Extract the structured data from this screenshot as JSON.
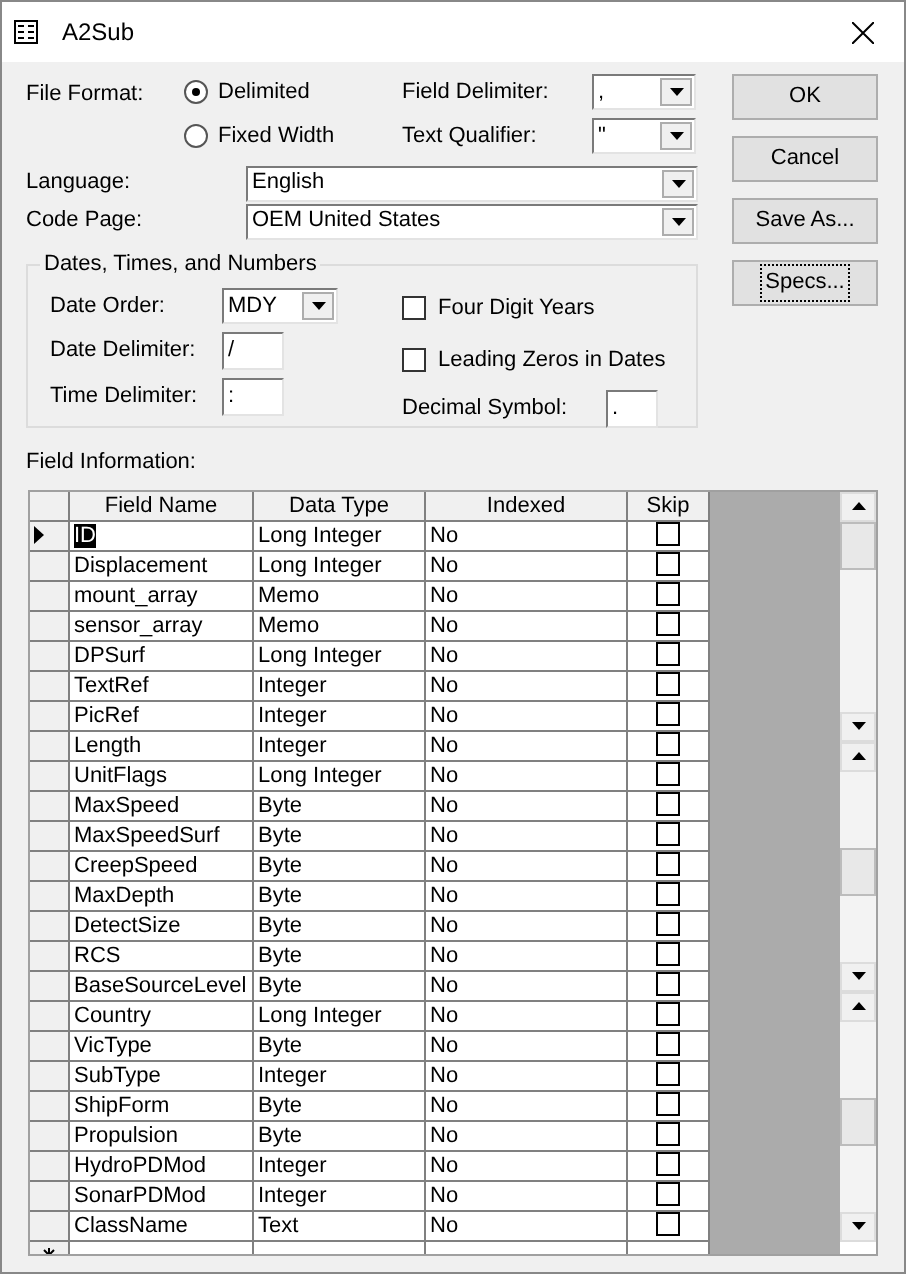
{
  "window": {
    "title": "A2Sub"
  },
  "file_format": {
    "label": "File Format:",
    "options": [
      {
        "label": "Delimited",
        "selected": true
      },
      {
        "label": "Fixed Width",
        "selected": false
      }
    ]
  },
  "field_delimiter": {
    "label": "Field Delimiter:",
    "value": ","
  },
  "text_qualifier": {
    "label": "Text Qualifier:",
    "value": "\""
  },
  "language": {
    "label": "Language:",
    "value": "English"
  },
  "code_page": {
    "label": "Code Page:",
    "value": "OEM United States"
  },
  "dates": {
    "title": "Dates, Times, and Numbers",
    "date_order": {
      "label": "Date Order:",
      "value": "MDY"
    },
    "date_delimiter": {
      "label": "Date Delimiter:",
      "value": "/"
    },
    "time_delimiter": {
      "label": "Time Delimiter:",
      "value": ":"
    },
    "four_digit_years": {
      "label": "Four Digit Years",
      "checked": false
    },
    "leading_zeros": {
      "label": "Leading Zeros in Dates",
      "checked": false
    },
    "decimal_symbol": {
      "label": "Decimal Symbol:",
      "value": "."
    }
  },
  "buttons": [
    {
      "label": "OK",
      "focused": false
    },
    {
      "label": "Cancel",
      "focused": false
    },
    {
      "label": "Save As...",
      "focused": false
    },
    {
      "label": "Specs...",
      "focused": true
    }
  ],
  "field_information": {
    "label": "Field Information:",
    "columns": [
      "Field Name",
      "Data Type",
      "Indexed",
      "Skip"
    ],
    "rows": [
      {
        "field_name": "ID",
        "data_type": "Long Integer",
        "indexed": "No",
        "skip": false,
        "selected": true
      },
      {
        "field_name": "Displacement",
        "data_type": "Long Integer",
        "indexed": "No",
        "skip": false,
        "selected": false
      },
      {
        "field_name": "mount_array",
        "data_type": "Memo",
        "indexed": "No",
        "skip": false,
        "selected": false
      },
      {
        "field_name": "sensor_array",
        "data_type": "Memo",
        "indexed": "No",
        "skip": false,
        "selected": false
      },
      {
        "field_name": "DPSurf",
        "data_type": "Long Integer",
        "indexed": "No",
        "skip": false,
        "selected": false
      },
      {
        "field_name": "TextRef",
        "data_type": "Integer",
        "indexed": "No",
        "skip": false,
        "selected": false
      },
      {
        "field_name": "PicRef",
        "data_type": "Integer",
        "indexed": "No",
        "skip": false,
        "selected": false
      },
      {
        "field_name": "Length",
        "data_type": "Integer",
        "indexed": "No",
        "skip": false,
        "selected": false
      },
      {
        "field_name": "UnitFlags",
        "data_type": "Long Integer",
        "indexed": "No",
        "skip": false,
        "selected": false
      },
      {
        "field_name": "MaxSpeed",
        "data_type": "Byte",
        "indexed": "No",
        "skip": false,
        "selected": false
      },
      {
        "field_name": "MaxSpeedSurf",
        "data_type": "Byte",
        "indexed": "No",
        "skip": false,
        "selected": false
      },
      {
        "field_name": "CreepSpeed",
        "data_type": "Byte",
        "indexed": "No",
        "skip": false,
        "selected": false
      },
      {
        "field_name": "MaxDepth",
        "data_type": "Byte",
        "indexed": "No",
        "skip": false,
        "selected": false
      },
      {
        "field_name": "DetectSize",
        "data_type": "Byte",
        "indexed": "No",
        "skip": false,
        "selected": false
      },
      {
        "field_name": "RCS",
        "data_type": "Byte",
        "indexed": "No",
        "skip": false,
        "selected": false
      },
      {
        "field_name": "BaseSourceLevel",
        "data_type": "Byte",
        "indexed": "No",
        "skip": false,
        "selected": false
      },
      {
        "field_name": "Country",
        "data_type": "Long Integer",
        "indexed": "No",
        "skip": false,
        "selected": false
      },
      {
        "field_name": "VicType",
        "data_type": "Byte",
        "indexed": "No",
        "skip": false,
        "selected": false
      },
      {
        "field_name": "SubType",
        "data_type": "Integer",
        "indexed": "No",
        "skip": false,
        "selected": false
      },
      {
        "field_name": "ShipForm",
        "data_type": "Byte",
        "indexed": "No",
        "skip": false,
        "selected": false
      },
      {
        "field_name": "Propulsion",
        "data_type": "Byte",
        "indexed": "No",
        "skip": false,
        "selected": false
      },
      {
        "field_name": "HydroPDMod",
        "data_type": "Integer",
        "indexed": "No",
        "skip": false,
        "selected": false
      },
      {
        "field_name": "SonarPDMod",
        "data_type": "Integer",
        "indexed": "No",
        "skip": false,
        "selected": false
      },
      {
        "field_name": "ClassName",
        "data_type": "Text",
        "indexed": "No",
        "skip": false,
        "selected": false
      }
    ]
  }
}
